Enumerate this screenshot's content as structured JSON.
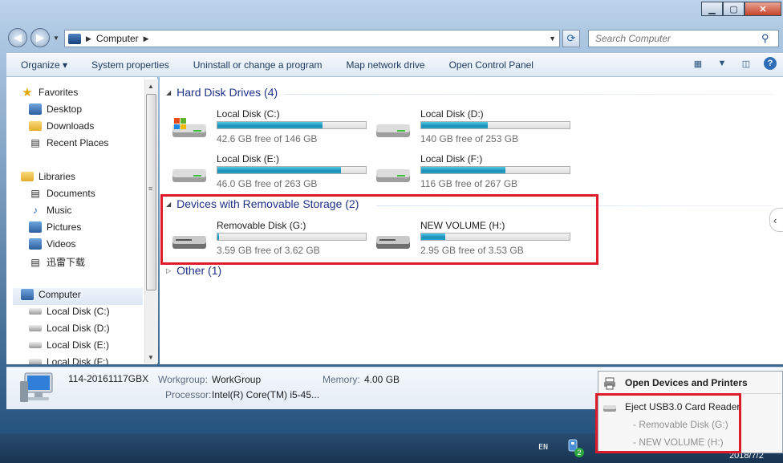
{
  "window": {
    "caption_buttons": [
      "minimize",
      "maximize",
      "close"
    ]
  },
  "address_bar": {
    "crumb": "Computer",
    "search_placeholder": "Search Computer"
  },
  "toolbar": {
    "organize": "Organize ▾",
    "system_properties": "System properties",
    "uninstall": "Uninstall or change a program",
    "map_network": "Map network drive",
    "control_panel": "Open Control Panel"
  },
  "nav": {
    "favorites": "Favorites",
    "desktop": "Desktop",
    "downloads": "Downloads",
    "recent": "Recent Places",
    "libraries": "Libraries",
    "documents": "Documents",
    "music": "Music",
    "pictures": "Pictures",
    "videos": "Videos",
    "xunlei": "迅雷下载",
    "computer": "Computer",
    "drive_c": "Local Disk (C:)",
    "drive_d": "Local Disk (D:)",
    "drive_e": "Local Disk (E:)",
    "drive_f": "Local Disk (F:)"
  },
  "groups": {
    "hdd": "Hard Disk Drives (4)",
    "removable": "Devices with Removable Storage (2)",
    "other": "Other (1)"
  },
  "drives": [
    {
      "name": "Local Disk (C:)",
      "free": "42.6 GB free of 146 GB",
      "used_fraction": 0.71
    },
    {
      "name": "Local Disk (D:)",
      "free": "140 GB free of 253 GB",
      "used_fraction": 0.45
    },
    {
      "name": "Local Disk (E:)",
      "free": "46.0 GB free of 263 GB",
      "used_fraction": 0.83
    },
    {
      "name": "Local Disk (F:)",
      "free": "116 GB free of 267 GB",
      "used_fraction": 0.57
    },
    {
      "name": "Removable Disk (G:)",
      "free": "3.59 GB free of 3.62 GB",
      "used_fraction": 0.01
    },
    {
      "name": "NEW VOLUME (H:)",
      "free": "2.95 GB free of 3.53 GB",
      "used_fraction": 0.16
    }
  ],
  "details": {
    "computer_name": "114-20161117GBX",
    "workgroup_label": "Workgroup:",
    "workgroup": "WorkGroup",
    "memory_label": "Memory:",
    "memory": "4.00 GB",
    "processor_label": "Processor:",
    "processor": "Intel(R) Core(TM) i5-45..."
  },
  "popup": {
    "open_devices": "Open Devices and Printers",
    "eject": "Eject USB3.0 Card Reader",
    "item_g": "- Removable Disk (G:)",
    "item_h": "- NEW VOLUME (H:)"
  },
  "taskbar": {
    "lang": "EN",
    "badge": "2",
    "clock_date": "2018/7/2"
  },
  "colors": {
    "highlight": "#dd1b2a",
    "bar_fill": "#26a3c8",
    "link": "#1e3287"
  }
}
